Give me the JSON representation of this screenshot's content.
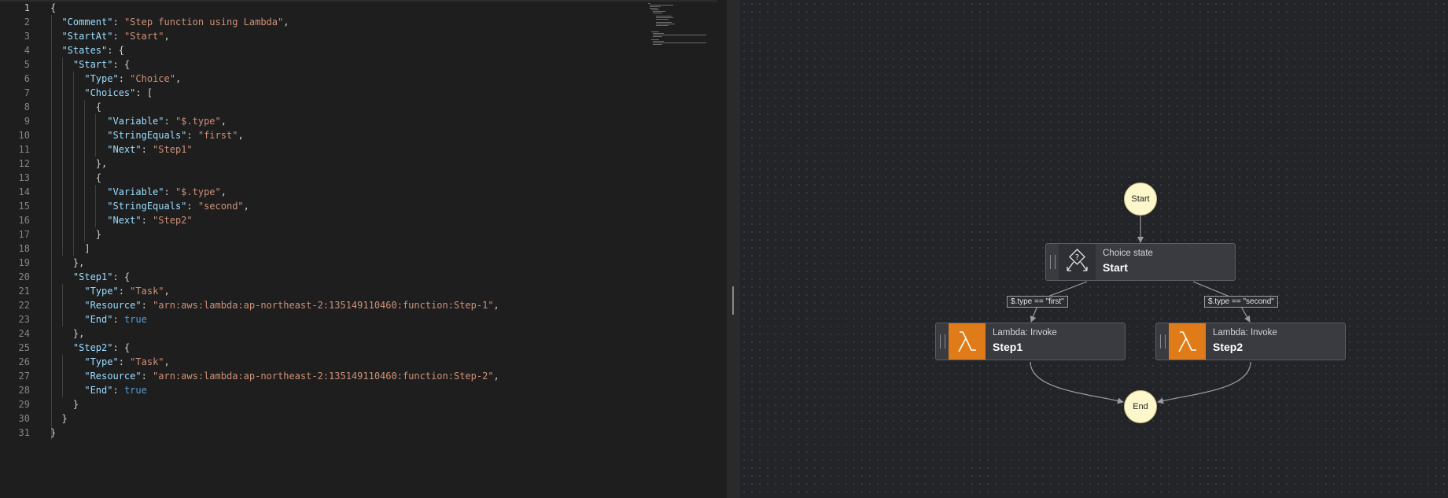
{
  "editor": {
    "line_numbers": [
      "1",
      "2",
      "3",
      "4",
      "5",
      "6",
      "7",
      "8",
      "9",
      "10",
      "11",
      "12",
      "13",
      "14",
      "15",
      "16",
      "17",
      "18",
      "19",
      "20",
      "21",
      "22",
      "23",
      "24",
      "25",
      "26",
      "27",
      "28",
      "29",
      "30",
      "31"
    ],
    "lines": [
      [
        {
          "t": "p",
          "v": "{"
        }
      ],
      [
        {
          "t": "p",
          "v": "  "
        },
        {
          "t": "k",
          "v": "\"Comment\""
        },
        {
          "t": "p",
          "v": ": "
        },
        {
          "t": "s",
          "v": "\"Step function using Lambda\""
        },
        {
          "t": "p",
          "v": ","
        }
      ],
      [
        {
          "t": "p",
          "v": "  "
        },
        {
          "t": "k",
          "v": "\"StartAt\""
        },
        {
          "t": "p",
          "v": ": "
        },
        {
          "t": "s",
          "v": "\"Start\""
        },
        {
          "t": "p",
          "v": ","
        }
      ],
      [
        {
          "t": "p",
          "v": "  "
        },
        {
          "t": "k",
          "v": "\"States\""
        },
        {
          "t": "p",
          "v": ": {"
        }
      ],
      [
        {
          "t": "p",
          "v": "    "
        },
        {
          "t": "k",
          "v": "\"Start\""
        },
        {
          "t": "p",
          "v": ": {"
        }
      ],
      [
        {
          "t": "p",
          "v": "      "
        },
        {
          "t": "k",
          "v": "\"Type\""
        },
        {
          "t": "p",
          "v": ": "
        },
        {
          "t": "s",
          "v": "\"Choice\""
        },
        {
          "t": "p",
          "v": ","
        }
      ],
      [
        {
          "t": "p",
          "v": "      "
        },
        {
          "t": "k",
          "v": "\"Choices\""
        },
        {
          "t": "p",
          "v": ": ["
        }
      ],
      [
        {
          "t": "p",
          "v": "        {"
        }
      ],
      [
        {
          "t": "p",
          "v": "          "
        },
        {
          "t": "k",
          "v": "\"Variable\""
        },
        {
          "t": "p",
          "v": ": "
        },
        {
          "t": "s",
          "v": "\"$.type\""
        },
        {
          "t": "p",
          "v": ","
        }
      ],
      [
        {
          "t": "p",
          "v": "          "
        },
        {
          "t": "k",
          "v": "\"StringEquals\""
        },
        {
          "t": "p",
          "v": ": "
        },
        {
          "t": "s",
          "v": "\"first\""
        },
        {
          "t": "p",
          "v": ","
        }
      ],
      [
        {
          "t": "p",
          "v": "          "
        },
        {
          "t": "k",
          "v": "\"Next\""
        },
        {
          "t": "p",
          "v": ": "
        },
        {
          "t": "s",
          "v": "\"Step1\""
        }
      ],
      [
        {
          "t": "p",
          "v": "        },"
        }
      ],
      [
        {
          "t": "p",
          "v": "        {"
        }
      ],
      [
        {
          "t": "p",
          "v": "          "
        },
        {
          "t": "k",
          "v": "\"Variable\""
        },
        {
          "t": "p",
          "v": ": "
        },
        {
          "t": "s",
          "v": "\"$.type\""
        },
        {
          "t": "p",
          "v": ","
        }
      ],
      [
        {
          "t": "p",
          "v": "          "
        },
        {
          "t": "k",
          "v": "\"StringEquals\""
        },
        {
          "t": "p",
          "v": ": "
        },
        {
          "t": "s",
          "v": "\"second\""
        },
        {
          "t": "p",
          "v": ","
        }
      ],
      [
        {
          "t": "p",
          "v": "          "
        },
        {
          "t": "k",
          "v": "\"Next\""
        },
        {
          "t": "p",
          "v": ": "
        },
        {
          "t": "s",
          "v": "\"Step2\""
        }
      ],
      [
        {
          "t": "p",
          "v": "        }"
        }
      ],
      [
        {
          "t": "p",
          "v": "      ]"
        }
      ],
      [
        {
          "t": "p",
          "v": "    },"
        }
      ],
      [
        {
          "t": "p",
          "v": "    "
        },
        {
          "t": "k",
          "v": "\"Step1\""
        },
        {
          "t": "p",
          "v": ": {"
        }
      ],
      [
        {
          "t": "p",
          "v": "      "
        },
        {
          "t": "k",
          "v": "\"Type\""
        },
        {
          "t": "p",
          "v": ": "
        },
        {
          "t": "s",
          "v": "\"Task\""
        },
        {
          "t": "p",
          "v": ","
        }
      ],
      [
        {
          "t": "p",
          "v": "      "
        },
        {
          "t": "k",
          "v": "\"Resource\""
        },
        {
          "t": "p",
          "v": ": "
        },
        {
          "t": "s",
          "v": "\"arn:aws:lambda:ap-northeast-2:135149110460:function:Step-1\""
        },
        {
          "t": "p",
          "v": ","
        }
      ],
      [
        {
          "t": "p",
          "v": "      "
        },
        {
          "t": "k",
          "v": "\"End\""
        },
        {
          "t": "p",
          "v": ": "
        },
        {
          "t": "b",
          "v": "true"
        }
      ],
      [
        {
          "t": "p",
          "v": "    },"
        }
      ],
      [
        {
          "t": "p",
          "v": "    "
        },
        {
          "t": "k",
          "v": "\"Step2\""
        },
        {
          "t": "p",
          "v": ": {"
        }
      ],
      [
        {
          "t": "p",
          "v": "      "
        },
        {
          "t": "k",
          "v": "\"Type\""
        },
        {
          "t": "p",
          "v": ": "
        },
        {
          "t": "s",
          "v": "\"Task\""
        },
        {
          "t": "p",
          "v": ","
        }
      ],
      [
        {
          "t": "p",
          "v": "      "
        },
        {
          "t": "k",
          "v": "\"Resource\""
        },
        {
          "t": "p",
          "v": ": "
        },
        {
          "t": "s",
          "v": "\"arn:aws:lambda:ap-northeast-2:135149110460:function:Step-2\""
        },
        {
          "t": "p",
          "v": ","
        }
      ],
      [
        {
          "t": "p",
          "v": "      "
        },
        {
          "t": "k",
          "v": "\"End\""
        },
        {
          "t": "p",
          "v": ": "
        },
        {
          "t": "b",
          "v": "true"
        }
      ],
      [
        {
          "t": "p",
          "v": "    }"
        }
      ],
      [
        {
          "t": "p",
          "v": "  }"
        }
      ],
      [
        {
          "t": "p",
          "v": "}"
        }
      ]
    ],
    "colors": {
      "key": "#9cdcfe",
      "string": "#ce9178",
      "boolean": "#569cd6",
      "punct": "#d4d4d4"
    }
  },
  "graph": {
    "start_label": "Start",
    "end_label": "End",
    "choice": {
      "type_label": "Choice state",
      "name": "Start",
      "icon": "choice-state-icon"
    },
    "step1": {
      "type_label": "Lambda: Invoke",
      "name": "Step1",
      "icon": "lambda-icon"
    },
    "step2": {
      "type_label": "Lambda: Invoke",
      "name": "Step2",
      "icon": "lambda-icon"
    },
    "edge_first": "$.type == \"first\"",
    "edge_second": "$.type == \"second\"",
    "colors": {
      "terminal": "#fef7cb",
      "lambda": "#e07b1a",
      "canvas": "#232428"
    }
  }
}
